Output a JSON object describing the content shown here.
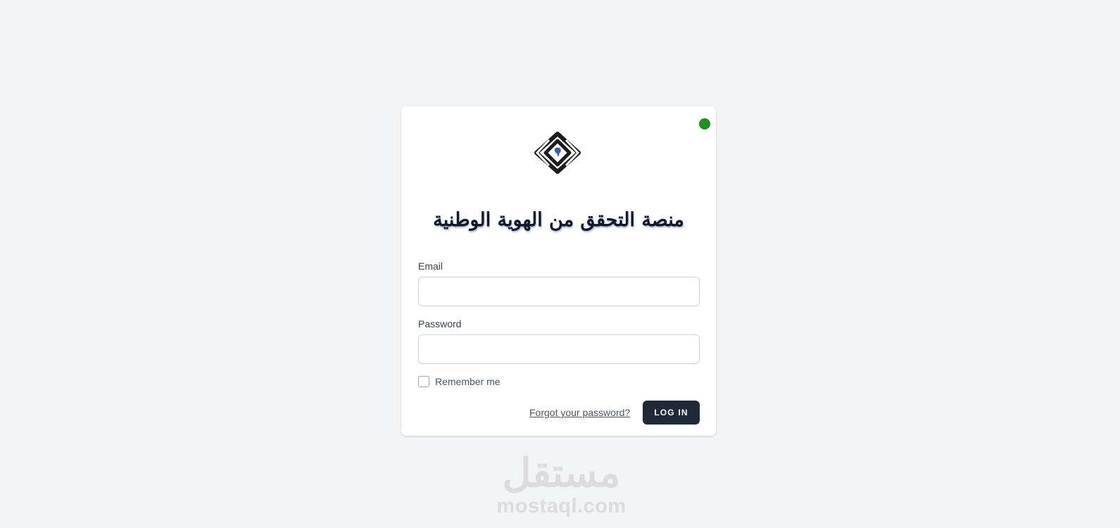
{
  "card": {
    "title": "منصة التحقق من الهوية الوطنية",
    "status_color": "#1f8f1f"
  },
  "form": {
    "email_label": "Email",
    "email_value": "",
    "password_label": "Password",
    "password_value": "",
    "remember_label": "Remember me",
    "remember_checked": false,
    "forgot_link": "Forgot your password?",
    "login_button": "LOG IN"
  },
  "watermark": {
    "arabic": "مستقل",
    "latin": "mostaql.com"
  },
  "colors": {
    "page_bg": "#f3f4f6",
    "button_bg": "#1f2937",
    "logo_dark": "#1c1c1c",
    "logo_accent": "#3b5ea8"
  },
  "icons": {
    "logo": "diamond-logo-icon",
    "status": "status-dot"
  }
}
